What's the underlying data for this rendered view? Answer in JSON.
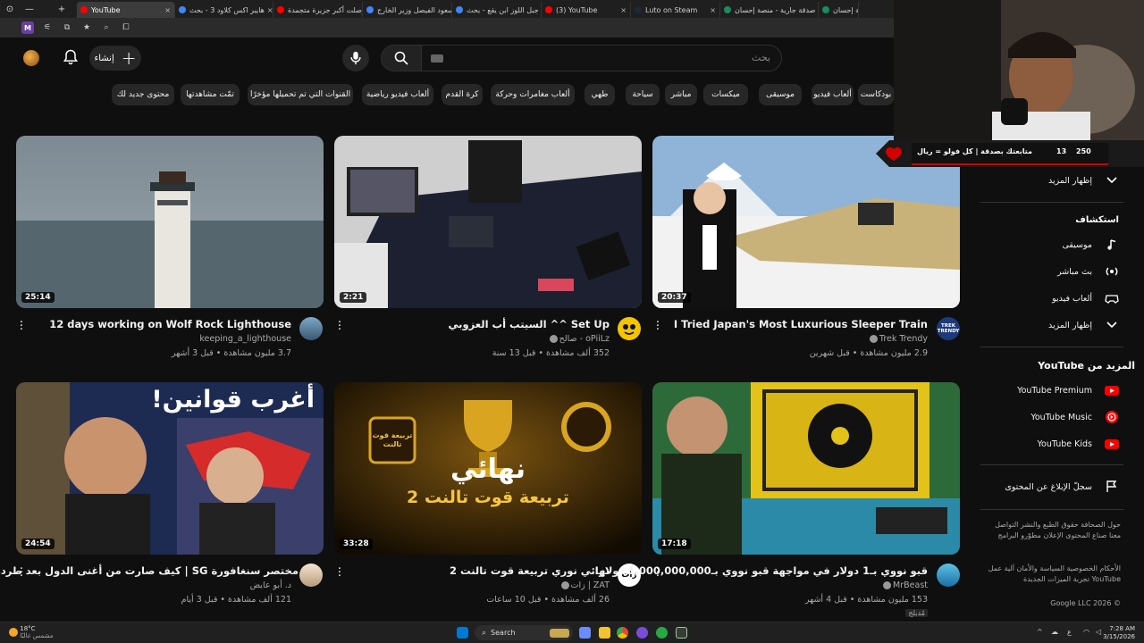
{
  "browser": {
    "tabs": [
      {
        "label": "YouTube",
        "active": true,
        "color": "#ff0000"
      },
      {
        "label": "هايبر اكس كلاود 3 - بحث",
        "active": false,
        "color": "#4285f4"
      },
      {
        "label": "وصلت أكبر جزيرة متجمدة",
        "active": false,
        "color": "#ff0000"
      },
      {
        "label": "سعود الفيصل وزير الخارج",
        "active": false,
        "color": "#4285f4"
      },
      {
        "label": "جبل اللوز ابن يقع - بحث",
        "active": false,
        "color": "#4285f4"
      },
      {
        "label": "(3) YouTube",
        "active": false,
        "color": "#ff0000"
      },
      {
        "label": "Luto on Steam",
        "active": false,
        "color": "#1b2838"
      },
      {
        "label": "صدقة جارية - منصة إحسان",
        "active": false,
        "color": "#1a8c5b"
      },
      {
        "label": "منصة إحسان",
        "active": false,
        "color": "#1a8c5b"
      }
    ]
  },
  "header": {
    "create_label": "إنشاء",
    "search_placeholder": "بحث"
  },
  "chips": [
    "بودكاست",
    "ألعاب فيديو",
    "موسيقى",
    "ميكسات",
    "مباشر",
    "سياحة",
    "طهي",
    "ألعاب مغامرات وحركة",
    "كرة القدم",
    "ألعاب فيديو رياضية",
    "القنوات التي تم تحميلها مؤخرًا",
    "تمّت مشاهدتها",
    "محتوى جديد لك"
  ],
  "videos": [
    {
      "title": "12 days working on Wolf Rock Lighthouse",
      "channel": "keeping_a_lighthouse",
      "meta": "3.7 مليون مشاهدة • قبل 3 أشهر",
      "duration": "25:14",
      "verified": false
    },
    {
      "title": "السيتب أب العزوبي ^^ Set Up",
      "channel": "صالح - oPiiLz",
      "meta": "352 ألف مشاهدة • قبل 13 سنة",
      "duration": "2:21",
      "verified": true
    },
    {
      "title": "I Tried Japan's Most Luxurious Sleeper Train",
      "channel": "Trek Trendy",
      "meta": "2.9 مليون مشاهدة • قبل شهرين",
      "duration": "20:37",
      "verified": true
    },
    {
      "title": "مختصر سنغافورة SG | كيف صارت من أغنى الدول بعد طردها؟",
      "channel": "د. أبو عايض",
      "meta": "121 ألف مشاهدة • قبل 3 أيام",
      "duration": "24:54",
      "verified": false
    },
    {
      "title": "نهائي نوري تربيعة قوت تالنت 2",
      "channel": "زات | ZAT",
      "meta": "26 ألف مشاهدة • قبل 10 ساعات",
      "duration": "33:28",
      "verified": true
    },
    {
      "title": "قبو نووي بـ1 دولار في مواجهة قبو نووي بـ1,000,000,000 دولار!",
      "channel": "MrBeast",
      "meta": "153 مليون مشاهدة • قبل 4 أشهر",
      "duration": "17:18",
      "verified": true,
      "extra": "مُدبلج"
    }
  ],
  "thumb_texts": {
    "singapore": "أغرب قوانين!",
    "final_line1": "نهائي",
    "final_line2": "تربيعة قوت تالنت 2",
    "medal": "تربيعة قوت تالنت",
    "trek_logo": "TREK TRENDY",
    "zat_logo": "زات"
  },
  "sidebar": {
    "show_more_1": "إظهار المزيد",
    "explore_title": "استكشاف",
    "explore": [
      {
        "label": "موسيقى",
        "icon": "music-note-icon"
      },
      {
        "label": "بث مباشر",
        "icon": "live-icon"
      },
      {
        "label": "ألعاب فيديو",
        "icon": "gaming-icon"
      }
    ],
    "show_more_2": "إظهار المزيد",
    "more_title": "المزيد من YouTube",
    "more": [
      {
        "label": "YouTube Premium",
        "icon": "youtube-premium-icon"
      },
      {
        "label": "YouTube Music",
        "icon": "youtube-music-icon"
      },
      {
        "label": "YouTube Kids",
        "icon": "youtube-kids-icon"
      }
    ],
    "report_history": "سجلّ الإبلاغ عن المحتوى",
    "footer1": "حول  الصحافة  حقوق الطبع والنشر  التواصل معنا  صناع المحتوى  الإعلان  مطوّرو البرامج",
    "footer2": "الأحكام  الخصوصية  السياسة والأمان  آلية عمل YouTube  تجربة الميزات الجديدة",
    "copyright": "© 2026 Google LLC"
  },
  "overlay": {
    "donation_text": "متابعتك بصدقة | كل فولو = ريال",
    "count_a": "13",
    "count_b": "250"
  },
  "taskbar": {
    "weather_temp": "18°C",
    "weather_desc": "مشمس غالبًا",
    "search_label": "Search",
    "time": "7:28 AM",
    "date": "3/15/2026"
  },
  "colors": {
    "yt_red": "#ff0000",
    "bg": "#0f0f0f",
    "chip_bg": "#272727"
  }
}
